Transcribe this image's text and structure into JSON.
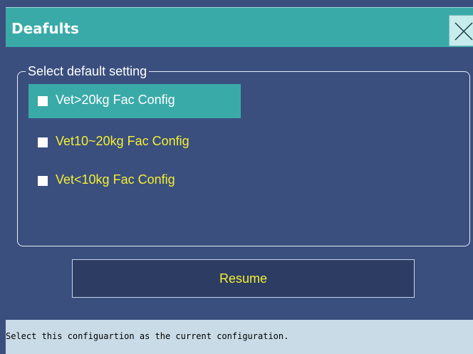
{
  "window": {
    "title": "Deafults",
    "close_icon": "close-x-icon"
  },
  "group": {
    "legend": "Select default setting",
    "options": [
      {
        "label": "Vet>20kg Fac Config",
        "selected": true
      },
      {
        "label": "Vet10~20kg Fac Config",
        "selected": false
      },
      {
        "label": "Vet<10kg Fac Config",
        "selected": false
      }
    ]
  },
  "buttons": {
    "resume_label": "Resume"
  },
  "status": {
    "text": "Select this configuartion as the current configuration."
  },
  "colors": {
    "background": "#3a4f7e",
    "titlebar": "#3aaaa8",
    "selected_option": "#3aaaa8",
    "option_text": "#f3ef34",
    "statusbar": "#c8dbe6"
  }
}
